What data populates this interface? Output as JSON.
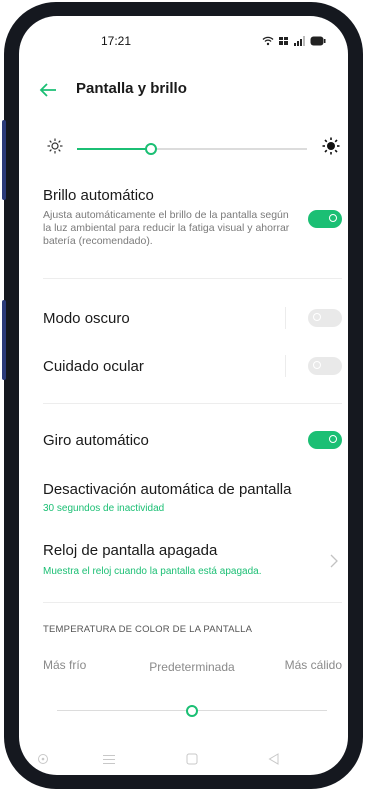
{
  "status_bar": {
    "time": "17:21"
  },
  "header": {
    "title": "Pantalla y brillo"
  },
  "brightness": {
    "level": 0.32
  },
  "auto_brightness": {
    "title": "Brillo automático",
    "description": "Ajusta automáticamente el brillo de la pantalla según la luz ambiental para reducir la fatiga visual y ahorrar batería (recomendado).",
    "enabled": true
  },
  "dark_mode": {
    "title": "Modo oscuro",
    "enabled": false
  },
  "eye_care": {
    "title": "Cuidado ocular",
    "enabled": false
  },
  "auto_rotate": {
    "title": "Giro automático",
    "enabled": true
  },
  "screen_timeout": {
    "title": "Desactivación automática de pantalla",
    "subtitle": "30 segundos de inactividad"
  },
  "aod_clock": {
    "title": "Reloj de pantalla apagada",
    "subtitle": "Muestra el reloj cuando la pantalla está apagada."
  },
  "color_temperature": {
    "section_title": "TEMPERATURA DE COLOR DE LA PANTALLA",
    "cold_label": "Más frío",
    "default_label": "Predeterminada",
    "warm_label": "Más cálido",
    "level": 0.5
  },
  "colors": {
    "accent": "#1bbf74",
    "frame": "#15181f"
  }
}
